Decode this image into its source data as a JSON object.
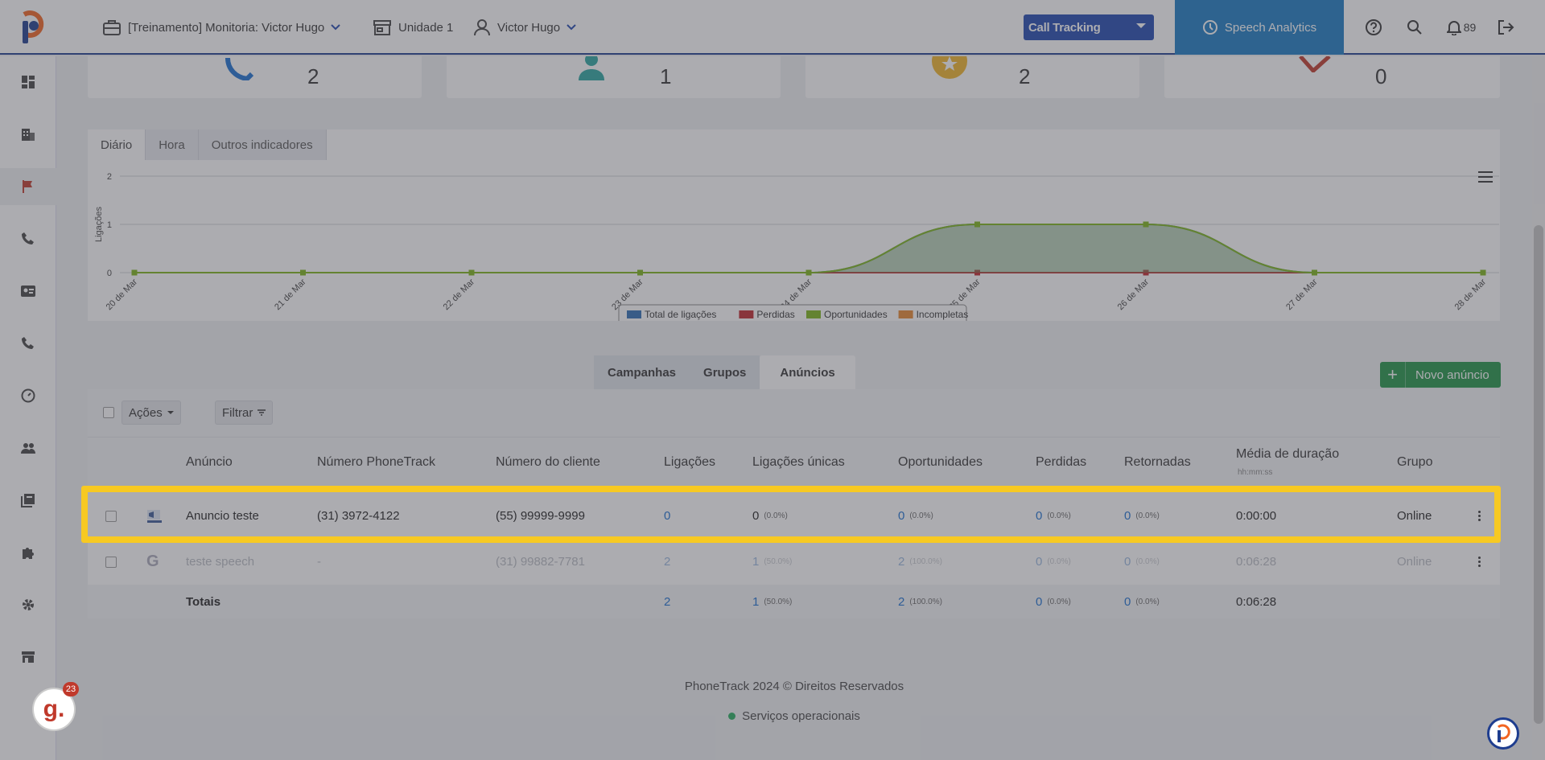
{
  "topbar": {
    "company": "[Treinamento] Monitoria: Victor Hugo",
    "unit": "Unidade 1",
    "user": "Victor Hugo",
    "product_select": "Call Tracking",
    "speech_analytics": "Speech Analytics",
    "notifications_count": "89",
    "colors": {
      "primary": "#1f47b0",
      "speech": "#1b7bc4",
      "brand_orange": "#f26522",
      "brand_blue": "#1e3d8f"
    }
  },
  "sidebar": {
    "items": [
      {
        "name": "dashboard-icon"
      },
      {
        "name": "building-icon"
      },
      {
        "name": "flag-icon",
        "active": true
      },
      {
        "name": "phone-icon"
      },
      {
        "name": "contact-card-icon"
      },
      {
        "name": "phone-icon-2"
      },
      {
        "name": "speedometer-icon"
      },
      {
        "name": "users-icon"
      },
      {
        "name": "book-icon"
      },
      {
        "name": "puzzle-icon"
      },
      {
        "name": "gear-icon"
      },
      {
        "name": "store-icon"
      }
    ]
  },
  "summary_cards": [
    {
      "icon": "phone-icon",
      "value": "2"
    },
    {
      "icon": "user-icon",
      "value": "1"
    },
    {
      "icon": "star-icon",
      "value": "2"
    },
    {
      "icon": "heart-broken-icon",
      "value": "0"
    }
  ],
  "chart_tabs": [
    "Diário",
    "Hora",
    "Outros indicadores"
  ],
  "chart_data": {
    "type": "area",
    "title": "",
    "xlabel": "",
    "ylabel": "Ligações",
    "ylim": [
      0,
      2
    ],
    "yticks": [
      "0",
      "1",
      "2"
    ],
    "categories": [
      "20 de Mar",
      "21 de Mar",
      "22 de Mar",
      "23 de Mar",
      "24 de Mar",
      "25 de Mar",
      "26 de Mar",
      "27 de Mar",
      "28 de Mar"
    ],
    "series": [
      {
        "name": "Total de ligações",
        "color": "#2e6db4",
        "values": [
          0,
          0,
          0,
          0,
          0,
          1,
          1,
          0,
          0
        ]
      },
      {
        "name": "Perdidas",
        "color": "#c0272d",
        "values": [
          0,
          0,
          0,
          0,
          0,
          0,
          0,
          0,
          0
        ]
      },
      {
        "name": "Oportunidades",
        "color": "#7cb518",
        "values": [
          0,
          0,
          0,
          0,
          0,
          1,
          1,
          0,
          0
        ]
      },
      {
        "name": "Incompletas",
        "color": "#e8872e",
        "values": [
          0,
          0,
          0,
          0,
          0,
          0,
          0,
          0,
          0
        ]
      }
    ],
    "legend": "bottom-center",
    "grid": true
  },
  "table_tabs": {
    "items": [
      "Campanhas",
      "Grupos",
      "Anúncios"
    ],
    "active": "Anúncios"
  },
  "new_ad_button": "Novo anúncio",
  "toolbar": {
    "actions": "Ações",
    "filter": "Filtrar"
  },
  "columns": {
    "ad": "Anúncio",
    "phonetrack_number": "Número PhoneTrack",
    "client_number": "Número do cliente",
    "calls": "Ligações",
    "unique_calls": "Ligações únicas",
    "opportunities": "Oportunidades",
    "lost": "Perdidas",
    "returned": "Retornadas",
    "avg_duration": "Média de duração",
    "avg_duration_sub": "hh:mm:ss",
    "group": "Grupo"
  },
  "rows": [
    {
      "source_icon": "facebook-icon",
      "ad": "Anuncio teste",
      "phonetrack_number": "(31) 3972-4122",
      "client_number": "(55) 99999-9999",
      "calls": "0",
      "unique_calls": "0",
      "unique_pct": "(0.0%)",
      "opportunities": "0",
      "opp_pct": "(0.0%)",
      "lost": "0",
      "lost_pct": "(0.0%)",
      "returned": "0",
      "returned_pct": "(0.0%)",
      "avg_duration": "0:00:00",
      "group": "Online"
    },
    {
      "source_icon": "google-icon",
      "ad": "teste speech",
      "phonetrack_number": "-",
      "client_number": "(31) 99882-7781",
      "calls": "2",
      "unique_calls": "1",
      "unique_pct": "(50.0%)",
      "opportunities": "2",
      "opp_pct": "(100.0%)",
      "lost": "0",
      "lost_pct": "(0.0%)",
      "returned": "0",
      "returned_pct": "(0.0%)",
      "avg_duration": "0:06:28",
      "group": "Online"
    }
  ],
  "totals": {
    "label": "Totais",
    "calls": "2",
    "unique_calls": "1",
    "unique_pct": "(50.0%)",
    "opportunities": "2",
    "opp_pct": "(100.0%)",
    "lost": "0",
    "lost_pct": "(0.0%)",
    "returned": "0",
    "returned_pct": "(0.0%)",
    "avg_duration": "0:06:28"
  },
  "footer": {
    "copyright": "PhoneTrack 2024 © Direitos Reservados",
    "status": "Serviços operacionais"
  },
  "chat_badge": {
    "letter": "g.",
    "count": "23"
  }
}
